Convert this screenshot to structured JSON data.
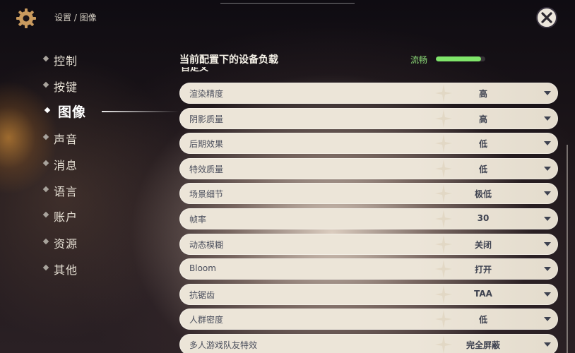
{
  "breadcrumb": {
    "parent": "设置",
    "separator": "/",
    "current": "图像"
  },
  "nav": {
    "items": [
      {
        "label": "控制",
        "active": false
      },
      {
        "label": "按键",
        "active": false
      },
      {
        "label": "图像",
        "active": true
      },
      {
        "label": "声音",
        "active": false
      },
      {
        "label": "消息",
        "active": false
      },
      {
        "label": "语言",
        "active": false
      },
      {
        "label": "账户",
        "active": false
      },
      {
        "label": "资源",
        "active": false
      },
      {
        "label": "其他",
        "active": false
      }
    ]
  },
  "panel": {
    "title": "当前配置下的设备负载",
    "performance": {
      "label": "流畅",
      "level": 0.92,
      "color": "#7fe56a"
    },
    "section_label": "自定义"
  },
  "settings": [
    {
      "label": "渲染精度",
      "value": "高"
    },
    {
      "label": "阴影质量",
      "value": "高"
    },
    {
      "label": "后期效果",
      "value": "低"
    },
    {
      "label": "特效质量",
      "value": "低"
    },
    {
      "label": "场景细节",
      "value": "极低"
    },
    {
      "label": "帧率",
      "value": "30"
    },
    {
      "label": "动态模糊",
      "value": "关闭"
    },
    {
      "label": "Bloom",
      "value": "打开"
    },
    {
      "label": "抗锯齿",
      "value": "TAA"
    },
    {
      "label": "人群密度",
      "value": "低"
    },
    {
      "label": "多人游戏队友特效",
      "value": "完全屏蔽"
    }
  ],
  "icons": {
    "settings": "gear-icon",
    "close": "close-icon",
    "dropdown": "chevron-down-icon"
  }
}
